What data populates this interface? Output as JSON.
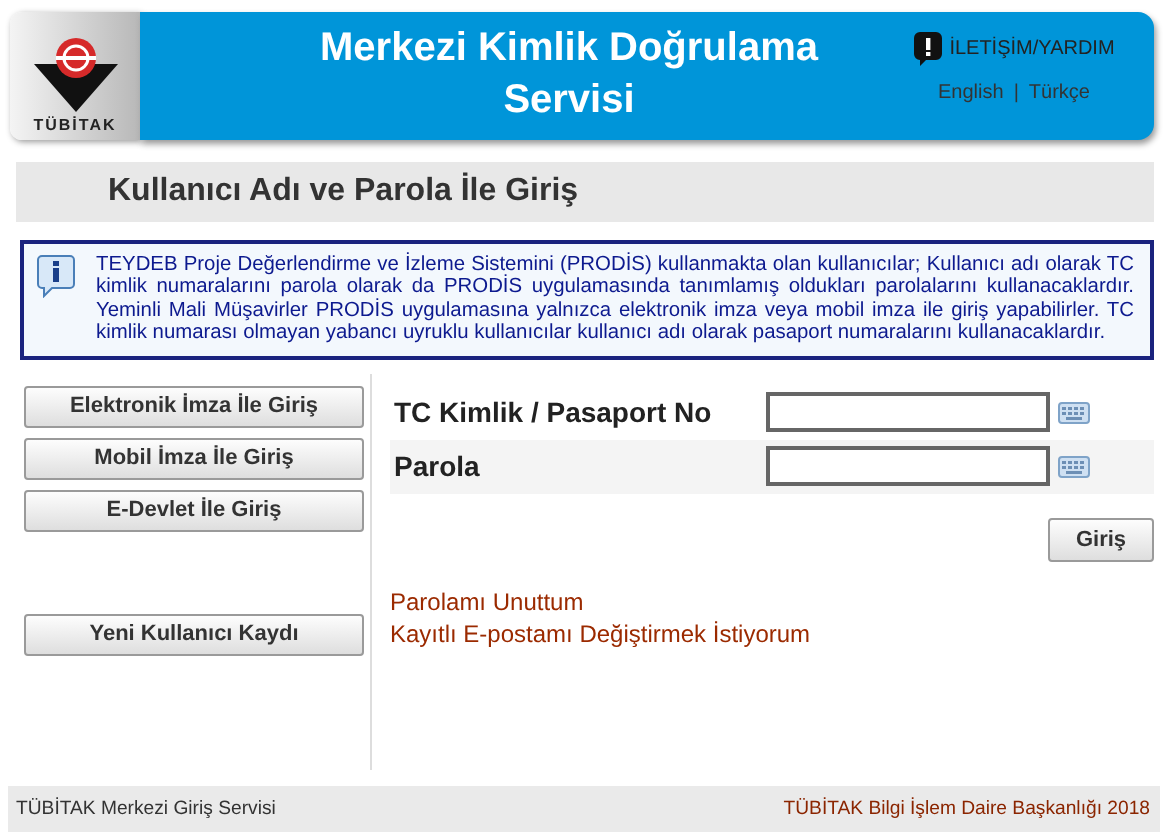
{
  "header": {
    "logo_text": "TÜBİTAK",
    "title": "Merkezi Kimlik Doğrulama Servisi",
    "help_link": "İLETİŞİM/YARDIM",
    "languages": [
      "English",
      "Türkçe"
    ],
    "separator": "|"
  },
  "page_title": "Kullanıcı Adı ve Parola İle Giriş",
  "info": "TEYDEB Proje Değerlendirme ve İzleme Sistemini (PRODİS) kullanmakta olan kullanıcılar; Kullanıcı adı olarak TC kimlik numaralarını parola olarak da PRODİS uygulamasında tanımlamış oldukları parolalarını kullanacaklardır. Yeminli Mali Müşavirler PRODİS uygulamasına yalnızca elektronik imza veya mobil imza ile giriş yapabilirler. TC kimlik numarası olmayan yabancı uyruklu kullanıcılar kullanıcı adı olarak pasaport numaralarını kullanacaklardır.",
  "login_options": [
    "Elektronik İmza İle Giriş",
    "Mobil İmza İle Giriş",
    "E-Devlet İle Giriş"
  ],
  "register_button": "Yeni Kullanıcı Kaydı",
  "fields": [
    {
      "label": "TC Kimlik / Pasaport No"
    },
    {
      "label": "Parola"
    }
  ],
  "submit_button": "Giriş",
  "links": [
    "Parolamı Unuttum",
    "Kayıtlı E-postamı Değiştirmek İstiyorum"
  ],
  "footer": {
    "left": "TÜBİTAK Merkezi Giriş Servisi",
    "right": "TÜBİTAK Bilgi İşlem Daire Başkanlığı 2018"
  }
}
